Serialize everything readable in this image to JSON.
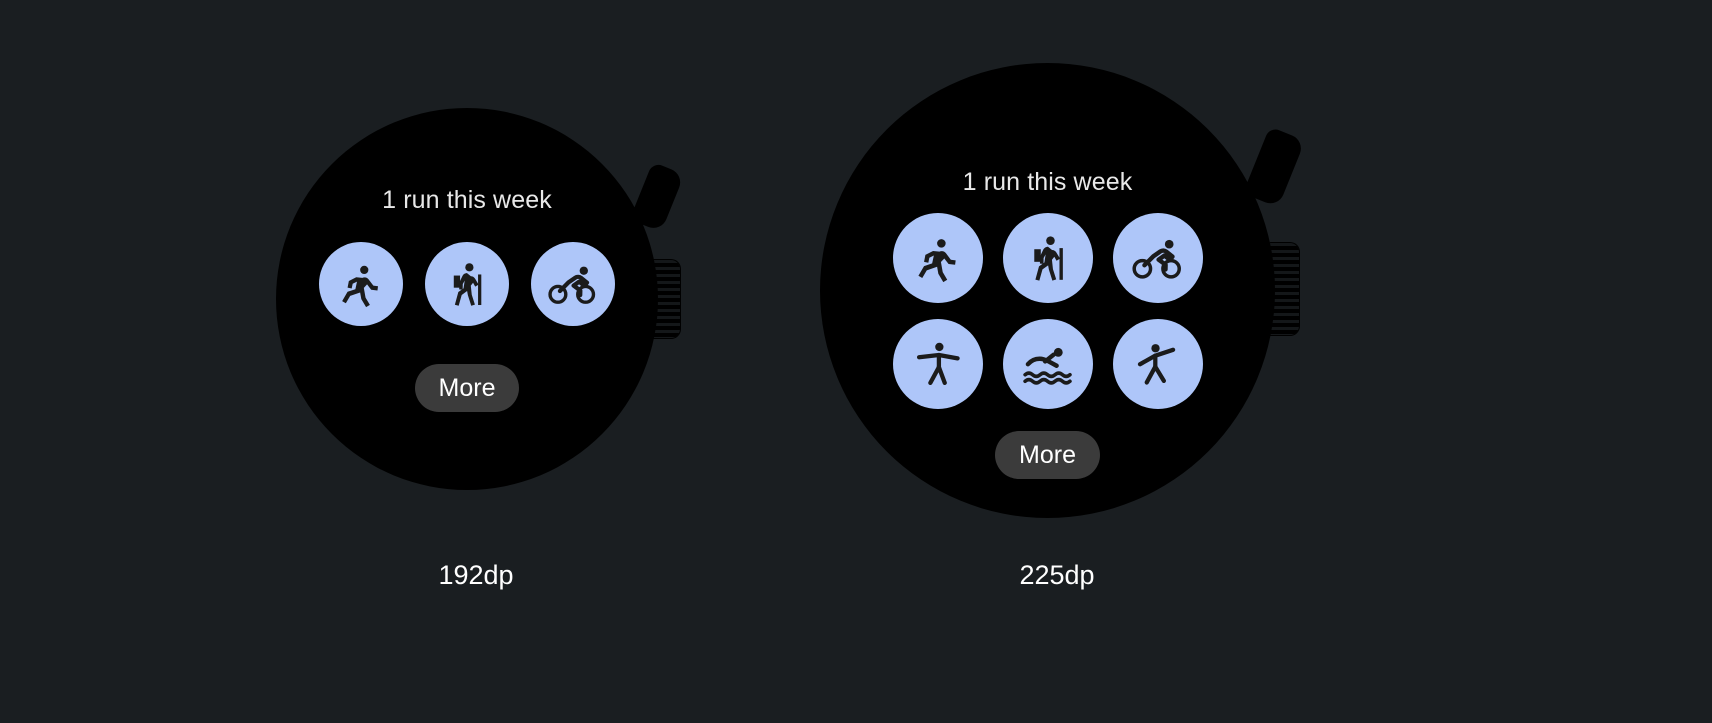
{
  "background_color": "#1a1e21",
  "accent_color": "#aec6f9",
  "screen_color": "#000000",
  "button_color": "#3b3b3b",
  "text_color": "#e8e8e8",
  "caption_color": "#ffffff",
  "watches": [
    {
      "id": "watch-small",
      "caption": "192dp",
      "title": "1 run this week",
      "more_label": "More",
      "activities": [
        {
          "name": "running-icon",
          "label": "Running"
        },
        {
          "name": "hiking-icon",
          "label": "Hiking"
        },
        {
          "name": "cycling-icon",
          "label": "Cycling"
        }
      ]
    },
    {
      "id": "watch-large",
      "caption": "225dp",
      "title": "1 run this week",
      "more_label": "More",
      "activities": [
        {
          "name": "running-icon",
          "label": "Running"
        },
        {
          "name": "hiking-icon",
          "label": "Hiking"
        },
        {
          "name": "cycling-icon",
          "label": "Cycling"
        },
        {
          "name": "stretching-icon",
          "label": "Stretching"
        },
        {
          "name": "swimming-icon",
          "label": "Swimming"
        },
        {
          "name": "yoga-icon",
          "label": "Yoga"
        }
      ]
    }
  ]
}
